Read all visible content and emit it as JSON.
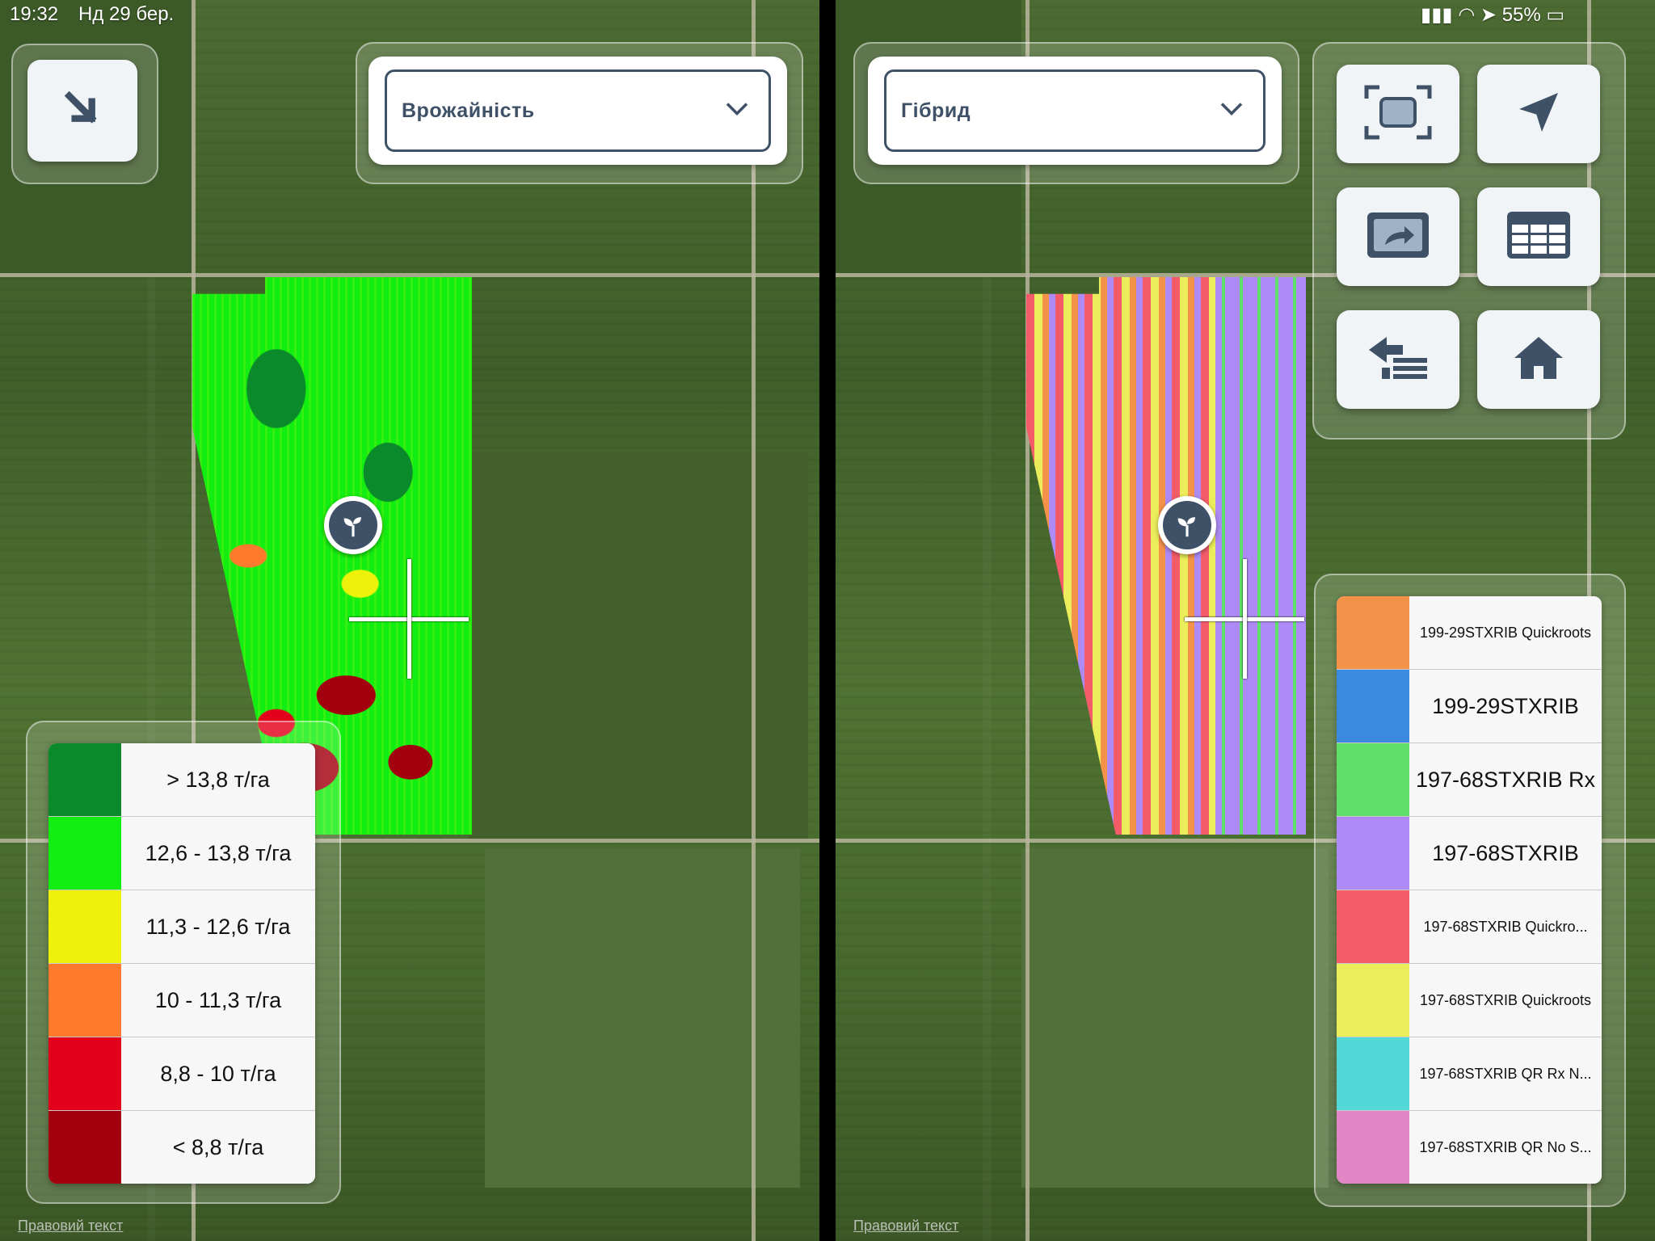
{
  "status_bar": {
    "time": "19:32",
    "date": "Нд 29 бер.",
    "battery": "55%"
  },
  "left_panel": {
    "layer_dropdown": {
      "value": "Врожайність"
    },
    "legend": [
      {
        "label": "> 13,8 т/га",
        "color": "#0a8a2a"
      },
      {
        "label": "12,6 - 13,8 т/га",
        "color": "#12ee12"
      },
      {
        "label": "11,3 - 12,6 т/га",
        "color": "#eef20a"
      },
      {
        "label": "10 - 11,3 т/га",
        "color": "#ff7a2c"
      },
      {
        "label": "8,8 - 10 т/га",
        "color": "#e3001b"
      },
      {
        "label": "< 8,8 т/га",
        "color": "#a3000f"
      }
    ],
    "legal_link": "Правовий текст"
  },
  "right_panel": {
    "layer_dropdown": {
      "value": "Гібрид"
    },
    "legend": [
      {
        "label": "199-29STXRIB Quickroots",
        "color": "#f5924a",
        "small": true
      },
      {
        "label": "199-29STXRIB",
        "color": "#3b8ae0",
        "small": false
      },
      {
        "label": "197-68STXRIB Rx",
        "color": "#5fe06a",
        "small": false
      },
      {
        "label": "197-68STXRIB",
        "color": "#ad8af5",
        "small": false
      },
      {
        "label": "197-68STXRIB Quickro...",
        "color": "#f45c6a",
        "small": true
      },
      {
        "label": "197-68STXRIB Quickroots",
        "color": "#ebed5a",
        "small": true
      },
      {
        "label": "197-68STXRIB QR Rx N...",
        "color": "#52d8d6",
        "small": true
      },
      {
        "label": "197-68STXRIB QR No S...",
        "color": "#e286c6",
        "small": true
      }
    ],
    "legal_link": "Правовий текст"
  },
  "icons": {
    "expand": "arrow-down-right-icon",
    "fit": "fit-extent-icon",
    "locate": "navigation-arrow-icon",
    "share": "share-screen-icon",
    "table": "table-icon",
    "back_list": "back-to-list-icon",
    "home": "home-icon",
    "field_pin": "sprout-icon",
    "chevron": "chevron-down-icon"
  }
}
